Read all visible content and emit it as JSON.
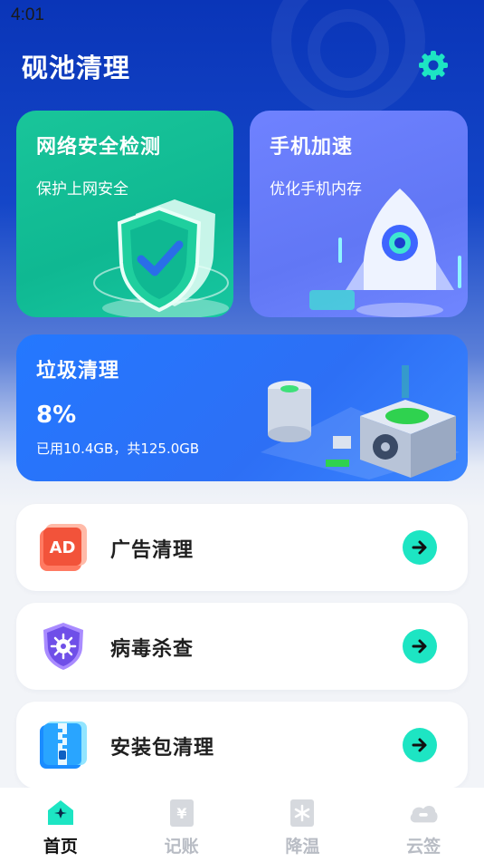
{
  "status_bar": {
    "time": "4:01"
  },
  "header": {
    "title": "砚池清理",
    "settings_icon": "gear-icon"
  },
  "cards": {
    "network": {
      "title": "网络安全检测",
      "subtitle": "保护上网安全",
      "color": "#19c59a"
    },
    "speed": {
      "title": "手机加速",
      "subtitle": "优化手机内存",
      "color": "#6f82ff"
    },
    "junk": {
      "title": "垃圾清理",
      "percent": "8%",
      "usage": "已用10.4GB，共125.0GB",
      "color": "#2478ff"
    }
  },
  "list": [
    {
      "label": "广告清理",
      "icon": "ad-icon"
    },
    {
      "label": "病毒杀查",
      "icon": "virus-shield-icon"
    },
    {
      "label": "安装包清理",
      "icon": "zip-package-icon"
    }
  ],
  "tabs": [
    {
      "label": "首页",
      "icon": "home-icon",
      "active": true
    },
    {
      "label": "记账",
      "icon": "ledger-icon",
      "active": false
    },
    {
      "label": "降温",
      "icon": "snowflake-icon",
      "active": false
    },
    {
      "label": "云签",
      "icon": "cloud-sign-icon",
      "active": false
    }
  ],
  "colors": {
    "accent": "#1de5c3",
    "hero_blue": "#0a35b8"
  }
}
